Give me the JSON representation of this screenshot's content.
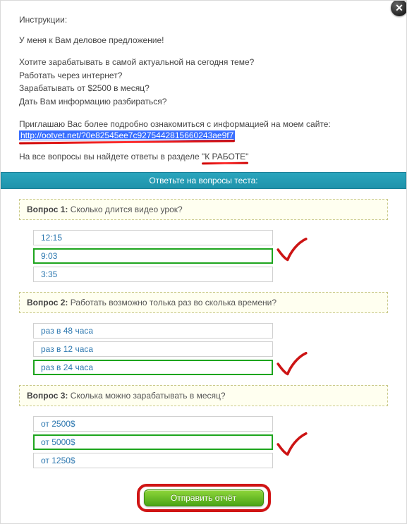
{
  "instructions_label": "Инструкции:",
  "intro": "У меня к Вам деловое предложение!",
  "pitch_lines": [
    "Хотите зарабатывать в самой актуальной на сегодня теме?",
    "Работать через интернет?",
    "Зарабатывать от $2500 в месяц?",
    "Дать Вам информацию разбираться?"
  ],
  "invite_prefix": "Приглашаю Вас более подробно ознакомиться с информацией на моем сайте:",
  "invite_link": "http://ootvet.net/?0e82545ee7c9275442815660243ae9f7",
  "answers_hint_prefix": "На все вопросы вы найдете ответы в разделе ",
  "answers_hint_section": "\"К РАБОТЕ\"",
  "test_header": "Ответьте на вопросы теста:",
  "questions": [
    {
      "label": "Вопрос 1:",
      "text": "Сколько длится видео урок?",
      "options": [
        "12:15",
        "9:03",
        "3:35"
      ],
      "selected": 1
    },
    {
      "label": "Вопрос 2:",
      "text": "Работать возможно толька раз во сколька времени?",
      "options": [
        "раз в 48 часа",
        "раз в 12 часа",
        "раз в 24 часа"
      ],
      "selected": 2
    },
    {
      "label": "Вопрос 3:",
      "text": "Сколька можно зарабатывать в месяц?",
      "options": [
        "от 2500$",
        "от 5000$",
        "от 1250$"
      ],
      "selected": 1
    }
  ],
  "submit_label": "Отправить отчёт",
  "close_label": "✕"
}
